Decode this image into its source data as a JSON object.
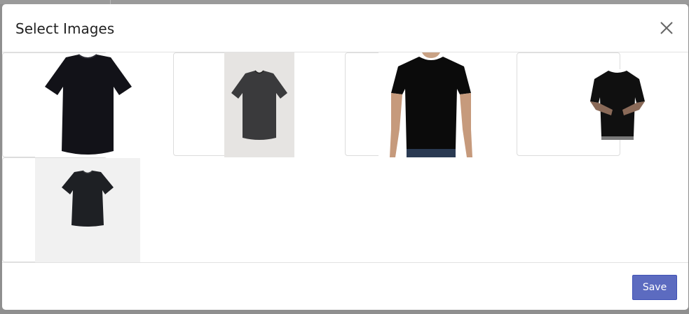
{
  "dialog": {
    "title": "Select Images",
    "close_icon": "close-icon",
    "save_label": "Save"
  },
  "images": [
    {
      "name": "black-tshirt-flat",
      "selected": false
    },
    {
      "name": "dark-grey-tshirt-hanging",
      "selected": false
    },
    {
      "name": "black-tshirt-model-front",
      "selected": false
    },
    {
      "name": "black-tshirt-model-tattoo",
      "selected": false
    },
    {
      "name": "black-tshirt-boxy-flat",
      "selected": false
    }
  ],
  "colors": {
    "accent": "#5c6bc0",
    "backdrop": "#8f8f8f"
  }
}
